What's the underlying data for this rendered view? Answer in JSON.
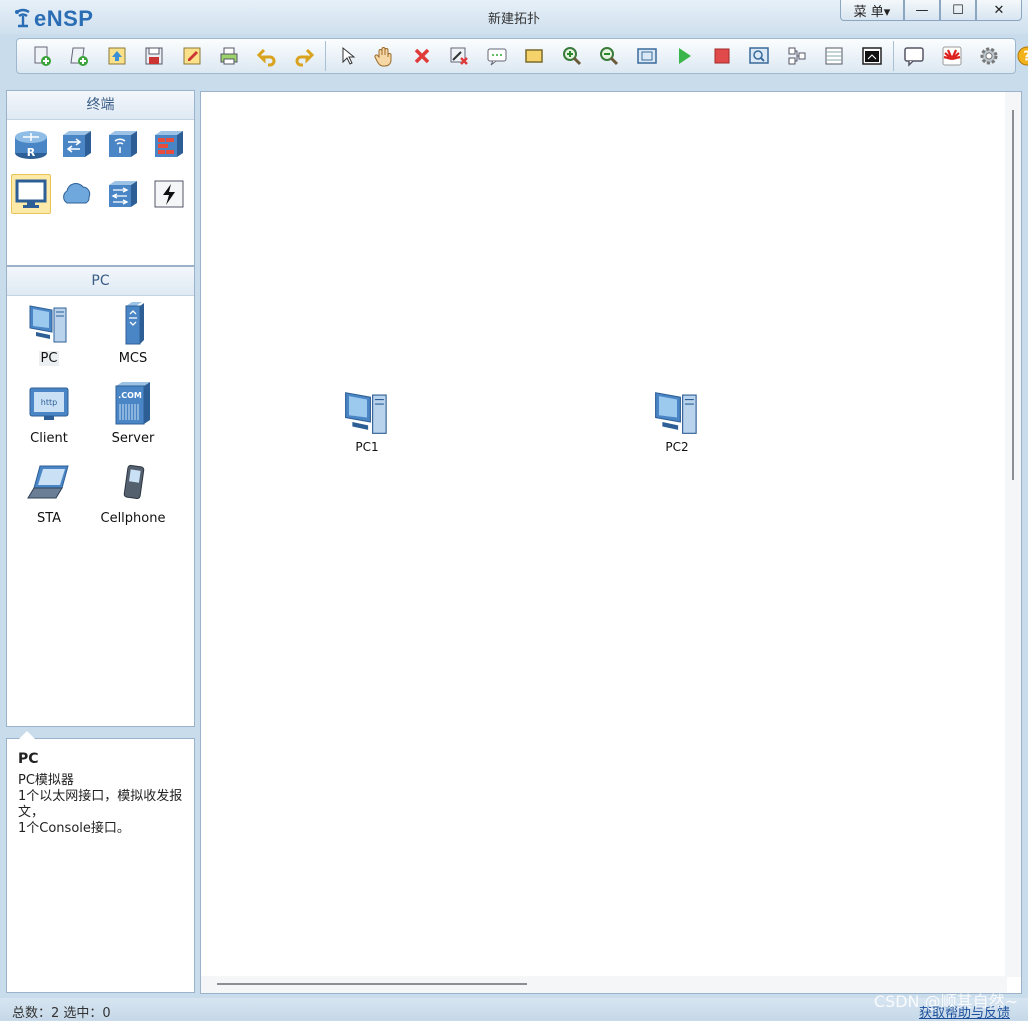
{
  "app": {
    "name": "eNSP",
    "window_title": "新建拓扑",
    "menu_label": "菜 单▾",
    "min_label": "—",
    "max_label": "☐",
    "close_label": "✕"
  },
  "toolbar": {
    "buttons": [
      "new-topology",
      "new-exam",
      "open",
      "save",
      "save-as",
      "print",
      "undo",
      "redo",
      "select",
      "drag",
      "delete",
      "delete-connection",
      "add-text",
      "add-shape",
      "zoom-in",
      "zoom-out",
      "fit-window",
      "start-device",
      "stop-device",
      "capture",
      "show-interface",
      "palette",
      "console",
      "chat",
      "huawei",
      "settings",
      "help"
    ]
  },
  "left_panel": {
    "category_title": "终端",
    "categories": [
      "router",
      "switch",
      "wireless",
      "firewall",
      "pc-terminal",
      "cloud",
      "multi-switch",
      "connection"
    ],
    "selected_category": "pc-terminal",
    "device_title": "PC",
    "devices": [
      {
        "label": "PC",
        "icon": "pc-icon"
      },
      {
        "label": "MCS",
        "icon": "mcs-icon"
      },
      {
        "label": "Client",
        "icon": "client-icon"
      },
      {
        "label": "Server",
        "icon": "server-icon"
      },
      {
        "label": "STA",
        "icon": "laptop-icon"
      },
      {
        "label": "Cellphone",
        "icon": "cellphone-icon"
      }
    ],
    "selected_device": "PC",
    "info": {
      "title": "PC",
      "line1": "PC模拟器",
      "line2": "1个以太网接口，模拟收发报文，",
      "line3": "1个Console接口。"
    }
  },
  "canvas": {
    "nodes": [
      {
        "label": "PC1"
      },
      {
        "label": "PC2"
      }
    ]
  },
  "status": {
    "text": "总数：2  选中：0",
    "link": "获取帮助与反馈"
  },
  "watermark": "CSDN @顺其自然~"
}
